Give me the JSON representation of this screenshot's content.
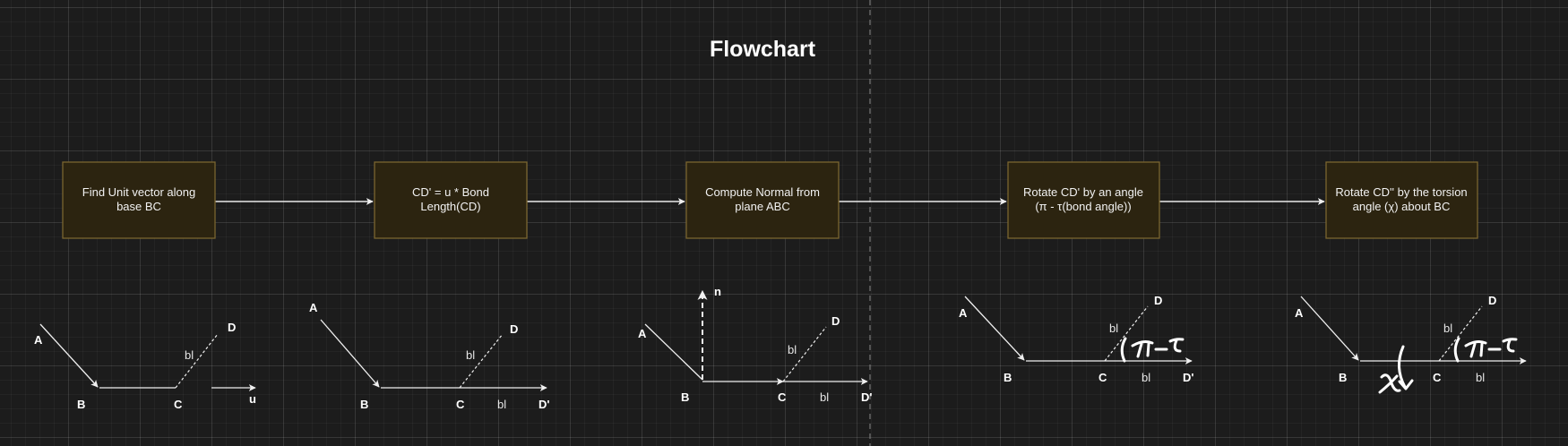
{
  "title": "Flowchart",
  "steps": [
    {
      "line1": "Find Unit vector along",
      "line2": "base BC"
    },
    {
      "line1": "CD' = u * Bond",
      "line2": "Length(CD)"
    },
    {
      "line1": "Compute Normal from",
      "line2": "plane ABC"
    },
    {
      "line1": "Rotate CD' by an angle",
      "line2": "(π - τ(bond angle))"
    },
    {
      "line1": "Rotate CD'' by the torsion",
      "line2": "angle (χ) about BC"
    }
  ],
  "labels": {
    "A": "A",
    "B": "B",
    "C": "C",
    "D": "D",
    "D_prime": "D'",
    "u": "u",
    "n": "n",
    "bl": "bl"
  },
  "annotations": {
    "pi_minus_tau": "π-τ",
    "chi": "χ"
  },
  "colors": {
    "background": "#1c1c1c",
    "box_fill": "#2c2410",
    "box_border": "#7a6530",
    "stroke": "#f0f0f0"
  }
}
